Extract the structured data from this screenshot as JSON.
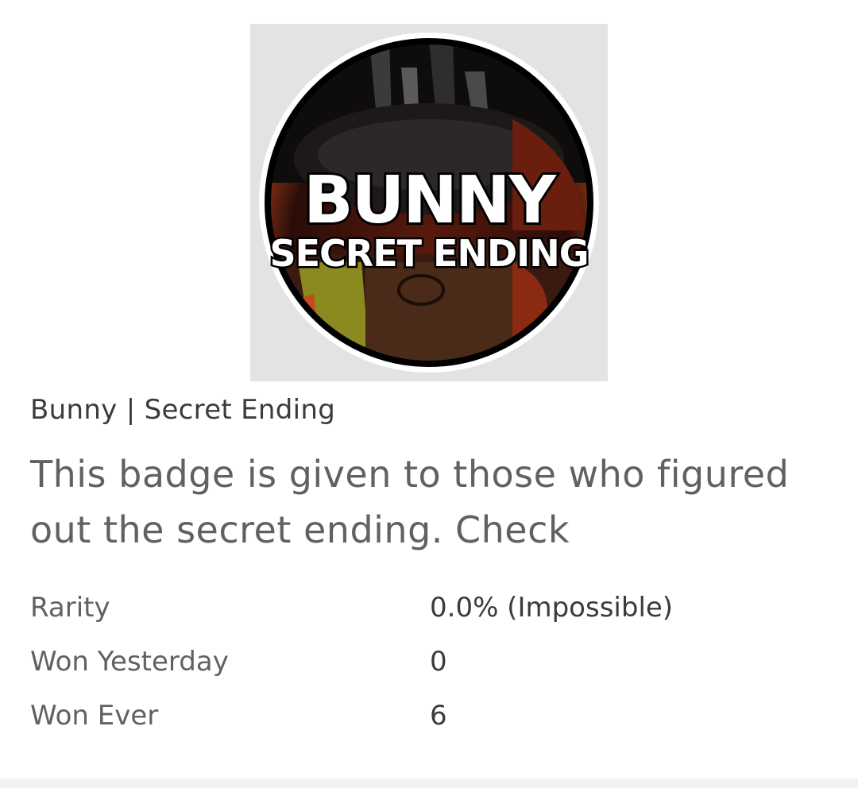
{
  "badge": {
    "image_title_line1": "BUNNY",
    "image_title_line2": "SECRET ENDING",
    "name": "Bunny | Secret Ending",
    "description": "This badge is given to those who figured out the secret ending. Check"
  },
  "stats": [
    {
      "label": "Rarity",
      "value": "0.0% (Impossible)"
    },
    {
      "label": "Won Yesterday",
      "value": "0"
    },
    {
      "label": "Won Ever",
      "value": "6"
    }
  ],
  "colors": {
    "background": "#ffffff",
    "label_text": "#606162",
    "value_text": "#393b3d",
    "thumbnail_frame": "#e3e3e3",
    "badge_dark": "#1a1514",
    "badge_rust": "#8a2a12",
    "badge_orange": "#c44a1c",
    "badge_olive": "#8a8a1e"
  }
}
